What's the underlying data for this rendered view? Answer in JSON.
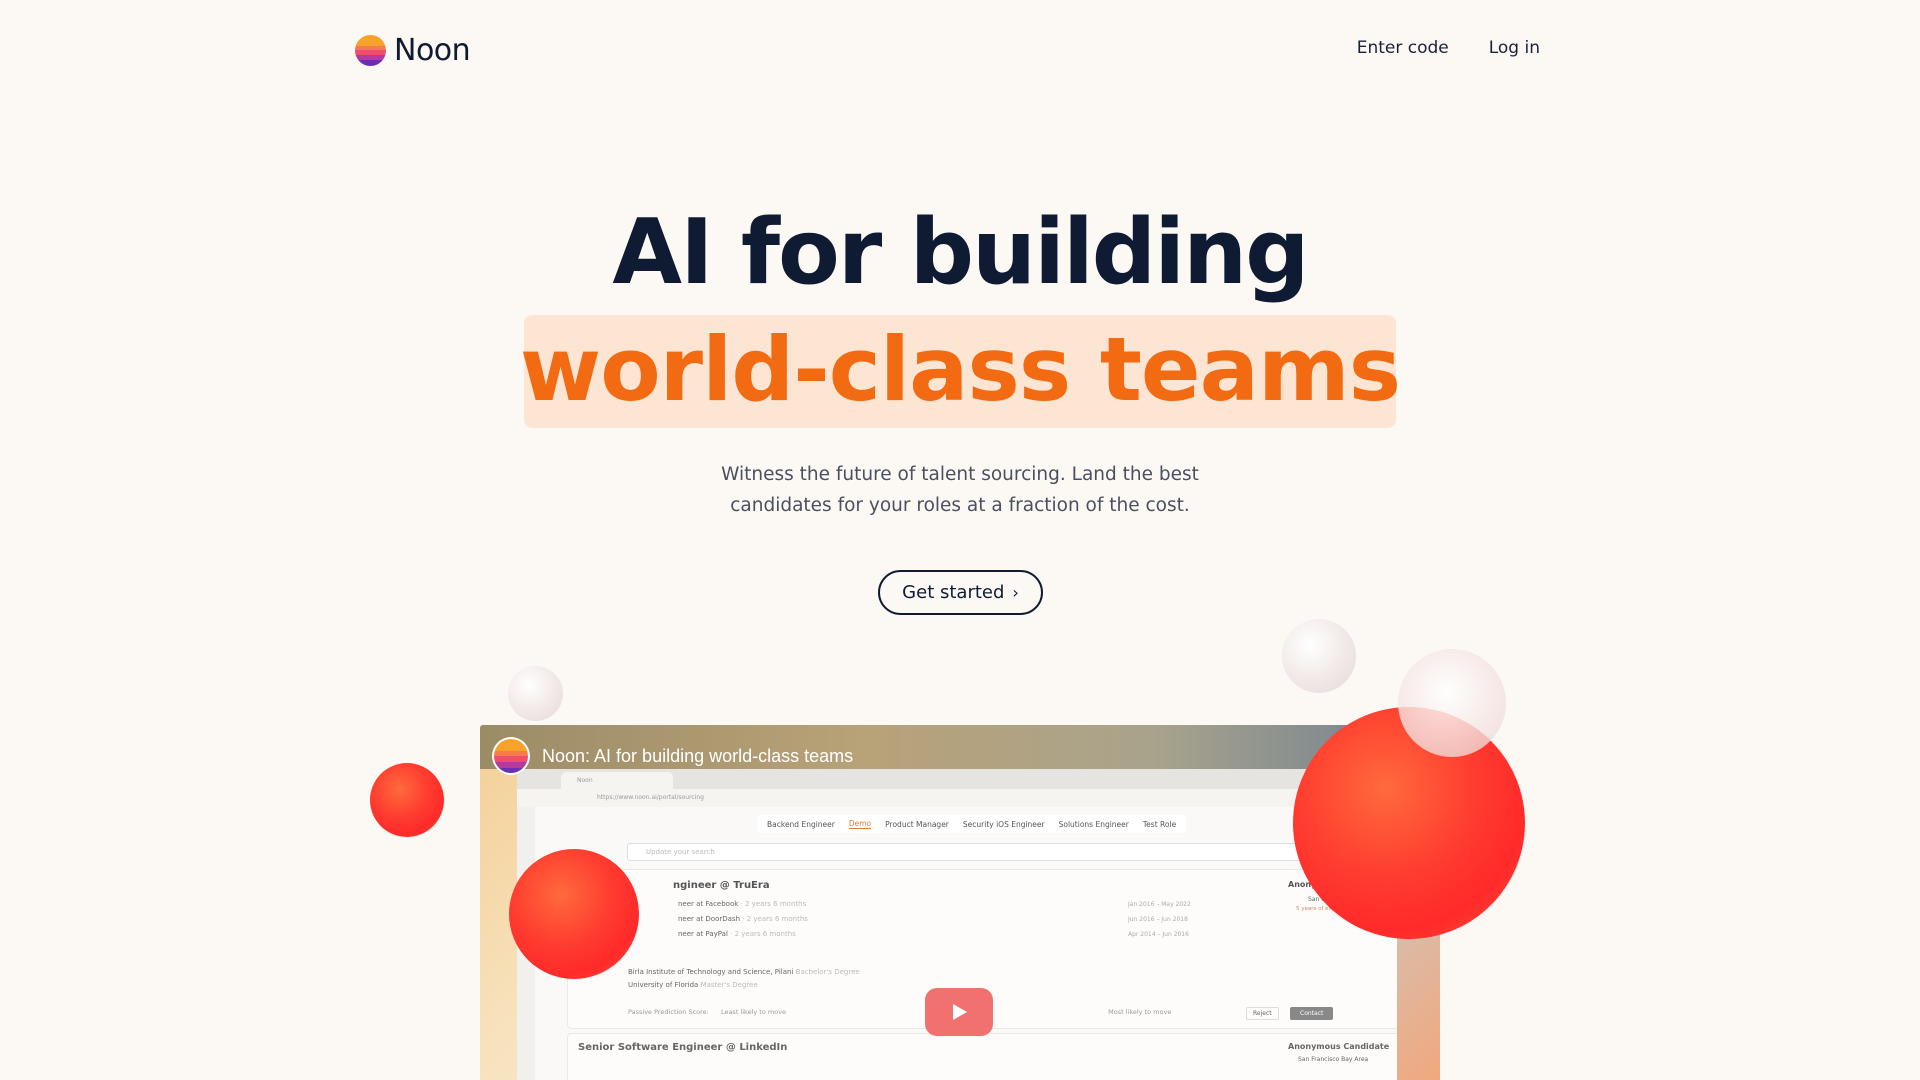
{
  "nav": {
    "brand_name": "Noon",
    "links": [
      "Enter code",
      "Log in"
    ]
  },
  "hero": {
    "headline_line1": "AI for building",
    "headline_line2": "world-class teams",
    "subtitle_line1": "Witness the future of talent sourcing. Land the best",
    "subtitle_line2": "candidates for your roles at a fraction of the cost.",
    "cta_label": "Get started",
    "cta_icon": "chevron-right-icon"
  },
  "video": {
    "title": "Noon: AI for building world-class teams",
    "browser_url": "https://www.noon.ai/portal/sourcing",
    "browser_tab": "Noon",
    "role_tabs": [
      "Backend Engineer",
      "Demo",
      "Product Manager",
      "Security iOS Engineer",
      "Solutions Engineer",
      "Test Role"
    ],
    "active_role_tab": "Demo",
    "search_placeholder": "Update your search",
    "candidate_title": "ngineer @ TruEra",
    "experience": [
      {
        "role": "neer at Facebook",
        "duration": "· 2 years 6 months",
        "dates": "Jan 2016 – May 2022"
      },
      {
        "role": "neer at DoorDash",
        "duration": "· 2 years 6 months",
        "dates": "Jun 2016 – Jun 2018"
      },
      {
        "role": "neer at PayPal",
        "duration": "· 2 years 6 months",
        "dates": "Apr 2014 – Jun 2016"
      }
    ],
    "education": [
      {
        "school": "Birla Institute of Technology and Science, Pilani",
        "degree": "Bachelor's Degree"
      },
      {
        "school": "University of Florida",
        "degree": "Master's Degree"
      }
    ],
    "prediction_label": "Passive Prediction Score:",
    "prediction_low": "Least likely to move",
    "prediction_high": "Most likely to move",
    "anon_label": "Anonymo",
    "location": "San Francisco",
    "years_experience": "5 years of experience",
    "reject_label": "Reject",
    "contact_label": "Contact",
    "card2_title": "Senior Software Engineer @ LinkedIn",
    "card2_anon": "Anonymous Candidate",
    "card2_location": "San Francisco Bay Area",
    "play_icon": "play-icon"
  },
  "colors": {
    "background": "#fcf8f4",
    "heading": "#0f1b33",
    "accent_orange": "#f26a11",
    "highlight_bg": "#fde5d3",
    "play_button": "#f0716e",
    "sphere_red": "#ff3b2f"
  }
}
